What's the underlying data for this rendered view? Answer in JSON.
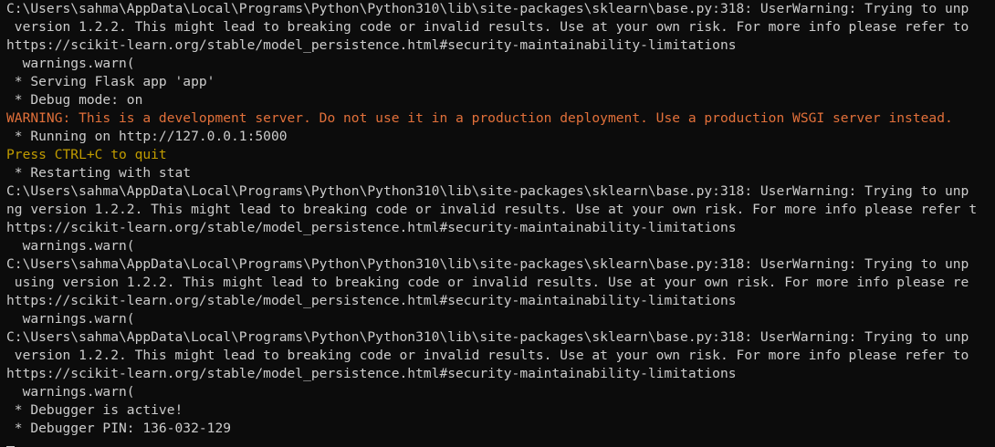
{
  "terminal": {
    "colors": {
      "background": "#0c0c0c",
      "text": "#cccccc",
      "warning": "#e2703a",
      "notice": "#c19c00"
    },
    "lines": [
      {
        "text": "C:\\Users\\sahma\\AppData\\Local\\Programs\\Python\\Python310\\lib\\site-packages\\sklearn\\base.py:318: UserWarning: Trying to unp",
        "style": "normal"
      },
      {
        "text": " version 1.2.2. This might lead to breaking code or invalid results. Use at your own risk. For more info please refer to",
        "style": "normal"
      },
      {
        "text": "https://scikit-learn.org/stable/model_persistence.html#security-maintainability-limitations",
        "style": "normal"
      },
      {
        "text": "  warnings.warn(",
        "style": "normal"
      },
      {
        "text": " * Serving Flask app 'app'",
        "style": "normal"
      },
      {
        "text": " * Debug mode: on",
        "style": "normal"
      },
      {
        "text": "WARNING: This is a development server. Do not use it in a production deployment. Use a production WSGI server instead.",
        "style": "warn"
      },
      {
        "text": " * Running on http://127.0.0.1:5000",
        "style": "normal"
      },
      {
        "text": "Press CTRL+C to quit",
        "style": "yellow"
      },
      {
        "text": " * Restarting with stat",
        "style": "normal"
      },
      {
        "text": "C:\\Users\\sahma\\AppData\\Local\\Programs\\Python\\Python310\\lib\\site-packages\\sklearn\\base.py:318: UserWarning: Trying to unp",
        "style": "normal"
      },
      {
        "text": "ng version 1.2.2. This might lead to breaking code or invalid results. Use at your own risk. For more info please refer t",
        "style": "normal"
      },
      {
        "text": "https://scikit-learn.org/stable/model_persistence.html#security-maintainability-limitations",
        "style": "normal"
      },
      {
        "text": "  warnings.warn(",
        "style": "normal"
      },
      {
        "text": "C:\\Users\\sahma\\AppData\\Local\\Programs\\Python\\Python310\\lib\\site-packages\\sklearn\\base.py:318: UserWarning: Trying to unp",
        "style": "normal"
      },
      {
        "text": " using version 1.2.2. This might lead to breaking code or invalid results. Use at your own risk. For more info please re",
        "style": "normal"
      },
      {
        "text": "https://scikit-learn.org/stable/model_persistence.html#security-maintainability-limitations",
        "style": "normal"
      },
      {
        "text": "  warnings.warn(",
        "style": "normal"
      },
      {
        "text": "C:\\Users\\sahma\\AppData\\Local\\Programs\\Python\\Python310\\lib\\site-packages\\sklearn\\base.py:318: UserWarning: Trying to unp",
        "style": "normal"
      },
      {
        "text": " version 1.2.2. This might lead to breaking code or invalid results. Use at your own risk. For more info please refer to",
        "style": "normal"
      },
      {
        "text": "https://scikit-learn.org/stable/model_persistence.html#security-maintainability-limitations",
        "style": "normal"
      },
      {
        "text": "  warnings.warn(",
        "style": "normal"
      },
      {
        "text": " * Debugger is active!",
        "style": "normal"
      },
      {
        "text": " * Debugger PIN: 136-032-129",
        "style": "normal"
      }
    ]
  }
}
